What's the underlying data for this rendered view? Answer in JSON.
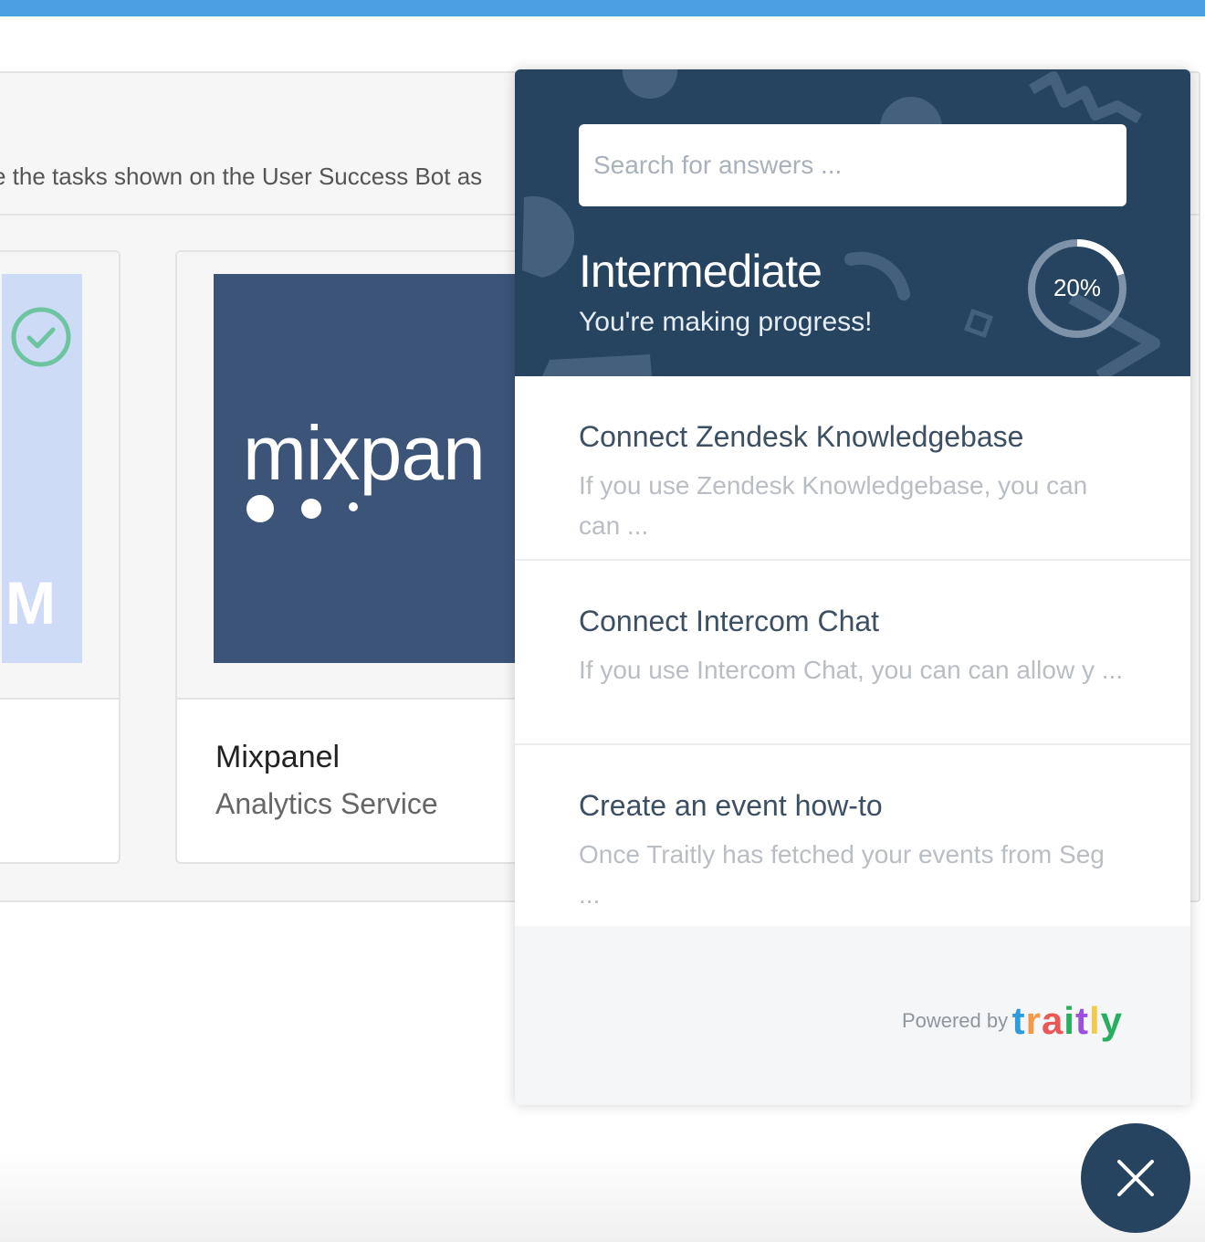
{
  "page": {
    "description_text": "e the tasks shown on the User Success Bot as"
  },
  "cards": [
    {
      "image_letter": "M",
      "completed": true,
      "icon": "check-circle-icon"
    },
    {
      "logo_text": "mixpan",
      "name": "Mixpanel",
      "subtitle": "Analytics Service"
    }
  ],
  "widget": {
    "search": {
      "placeholder": "Search for answers ..."
    },
    "level": {
      "title": "Intermediate",
      "subtitle": "You're making progress!"
    },
    "progress": {
      "value": 0.2,
      "label": "20%"
    },
    "tasks": [
      {
        "title": "Connect Zendesk Knowledgebase",
        "description": "If you use Zendesk Knowledgebase, you can can ..."
      },
      {
        "title": "Connect Intercom Chat",
        "description": "If you use Intercom Chat, you can can allow y ..."
      },
      {
        "title": "Create an event how-to",
        "description": "Once Traitly has fetched your events from Seg ..."
      }
    ],
    "footer": {
      "powered_by": "Powered by",
      "brand": "traitly",
      "brand_colors": [
        "#2d9cdb",
        "#f2994a",
        "#eb5757",
        "#27ae60",
        "#9b51e0",
        "#f2c94c",
        "#27ae60"
      ]
    },
    "colors": {
      "header_bg": "#26435f",
      "accent": "#4a9fe0",
      "check": "#6dc4a0"
    }
  },
  "close_button": {
    "icon": "close-icon"
  }
}
